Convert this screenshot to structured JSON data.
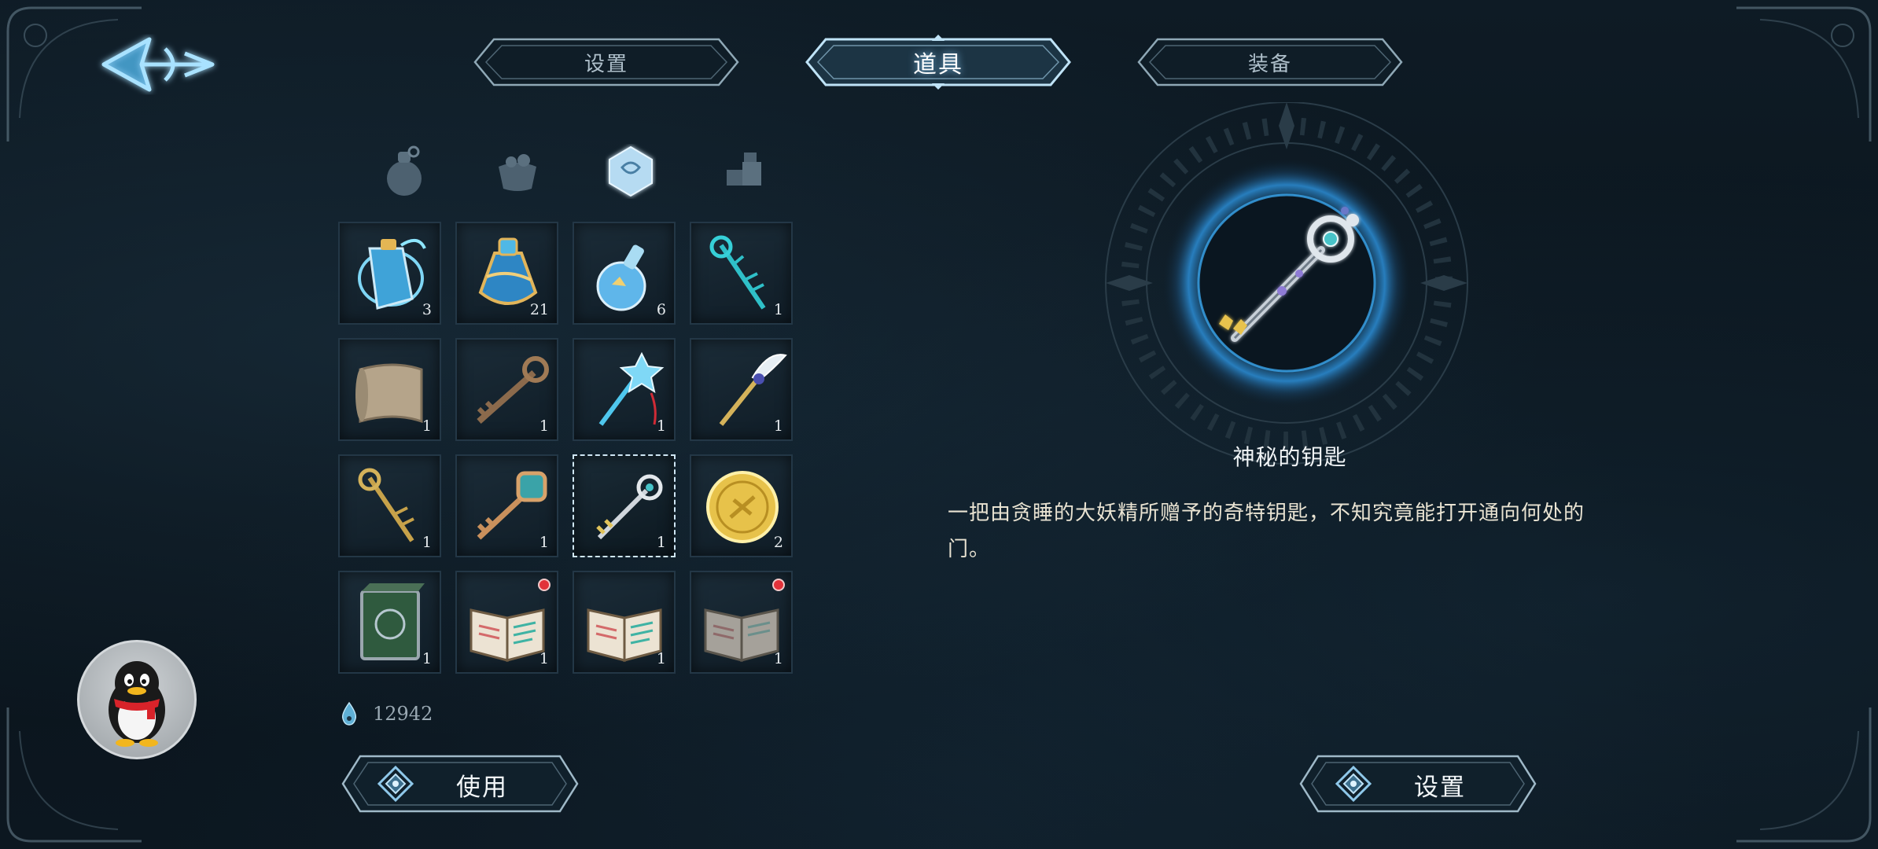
{
  "tabs": [
    {
      "label": "设置",
      "active": false
    },
    {
      "label": "道具",
      "active": true
    },
    {
      "label": "装备",
      "active": false
    }
  ],
  "categories": [
    {
      "icon": "potion-bag-icon",
      "active": false
    },
    {
      "icon": "food-basket-icon",
      "active": false
    },
    {
      "icon": "crystal-gem-icon",
      "active": true
    },
    {
      "icon": "materials-icon",
      "active": false
    }
  ],
  "inventory": {
    "items": [
      {
        "icon": "blue-elixir-vial-icon",
        "count": "3"
      },
      {
        "icon": "blue-potion-bottle-icon",
        "count": "21"
      },
      {
        "icon": "small-blue-potion-icon",
        "count": "6"
      },
      {
        "icon": "teal-thorn-key-icon",
        "count": "1"
      },
      {
        "icon": "old-scroll-icon",
        "count": "1"
      },
      {
        "icon": "bronze-key-icon",
        "count": "1"
      },
      {
        "icon": "crystal-star-key-icon",
        "count": "1"
      },
      {
        "icon": "winged-gold-key-icon",
        "count": "1"
      },
      {
        "icon": "dark-gold-key-icon",
        "count": "1"
      },
      {
        "icon": "ornate-copper-key-icon",
        "count": "1"
      },
      {
        "icon": "mysterious-silver-key-icon",
        "count": "1",
        "selected": true
      },
      {
        "icon": "gold-coin-icon",
        "count": "2"
      },
      {
        "icon": "green-tome-icon",
        "count": "1"
      },
      {
        "icon": "open-book-icon",
        "count": "1",
        "new": true
      },
      {
        "icon": "open-book-icon",
        "count": "1"
      },
      {
        "icon": "grey-open-book-icon",
        "count": "1",
        "new": true
      }
    ]
  },
  "currency": {
    "icon": "water-drop-icon",
    "value": "12942"
  },
  "buttons": {
    "use": "使用",
    "settings": "设置"
  },
  "detail": {
    "name": "神秘的钥匙",
    "description": "一把由贪睡的大妖精所赠予的奇特钥匙，不知究竟能打开通向何处的门。"
  },
  "colors": {
    "accent": "#8fd3ff",
    "frame": "#9fb9c8",
    "badge": "#e2323a",
    "coin": "#e7c24a"
  }
}
